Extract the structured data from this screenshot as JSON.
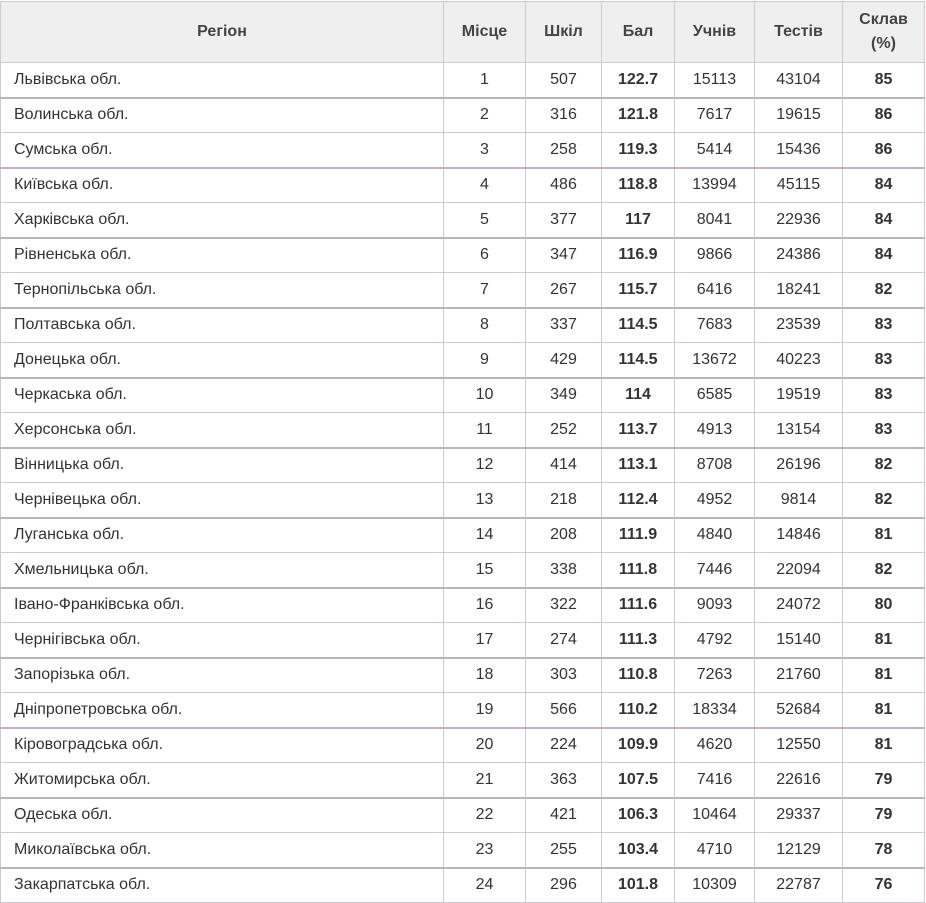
{
  "header": {
    "region": "Регіон",
    "place": "Місце",
    "schools": "Шкіл",
    "score": "Бал",
    "students": "Учнів",
    "tests": "Тестів",
    "passed": "Склав\n(%)"
  },
  "rows": [
    {
      "region": "Львівська обл.",
      "place": "1",
      "schools": "507",
      "score": "122.7",
      "students": "15113",
      "tests": "43104",
      "passed": "85"
    },
    {
      "region": "Волинська обл.",
      "place": "2",
      "schools": "316",
      "score": "121.8",
      "students": "7617",
      "tests": "19615",
      "passed": "86"
    },
    {
      "region": "Сумська обл.",
      "place": "3",
      "schools": "258",
      "score": "119.3",
      "students": "5414",
      "tests": "15436",
      "passed": "86"
    },
    {
      "region": "Київська обл.",
      "place": "4",
      "schools": "486",
      "score": "118.8",
      "students": "13994",
      "tests": "45115",
      "passed": "84"
    },
    {
      "region": "Харківська обл.",
      "place": "5",
      "schools": "377",
      "score": "117",
      "students": "8041",
      "tests": "22936",
      "passed": "84"
    },
    {
      "region": "Рівненська обл.",
      "place": "6",
      "schools": "347",
      "score": "116.9",
      "students": "9866",
      "tests": "24386",
      "passed": "84"
    },
    {
      "region": "Тернопільська обл.",
      "place": "7",
      "schools": "267",
      "score": "115.7",
      "students": "6416",
      "tests": "18241",
      "passed": "82"
    },
    {
      "region": "Полтавська обл.",
      "place": "8",
      "schools": "337",
      "score": "114.5",
      "students": "7683",
      "tests": "23539",
      "passed": "83"
    },
    {
      "region": "Донецька обл.",
      "place": "9",
      "schools": "429",
      "score": "114.5",
      "students": "13672",
      "tests": "40223",
      "passed": "83"
    },
    {
      "region": "Черкаська обл.",
      "place": "10",
      "schools": "349",
      "score": "114",
      "students": "6585",
      "tests": "19519",
      "passed": "83"
    },
    {
      "region": "Херсонська обл.",
      "place": "11",
      "schools": "252",
      "score": "113.7",
      "students": "4913",
      "tests": "13154",
      "passed": "83"
    },
    {
      "region": "Вінницька обл.",
      "place": "12",
      "schools": "414",
      "score": "113.1",
      "students": "8708",
      "tests": "26196",
      "passed": "82"
    },
    {
      "region": "Чернівецька обл.",
      "place": "13",
      "schools": "218",
      "score": "112.4",
      "students": "4952",
      "tests": "9814",
      "passed": "82"
    },
    {
      "region": "Луганська обл.",
      "place": "14",
      "schools": "208",
      "score": "111.9",
      "students": "4840",
      "tests": "14846",
      "passed": "81"
    },
    {
      "region": "Хмельницька обл.",
      "place": "15",
      "schools": "338",
      "score": "111.8",
      "students": "7446",
      "tests": "22094",
      "passed": "82"
    },
    {
      "region": "Івано-Франківська обл.",
      "place": "16",
      "schools": "322",
      "score": "111.6",
      "students": "9093",
      "tests": "24072",
      "passed": "80"
    },
    {
      "region": "Чернігівська обл.",
      "place": "17",
      "schools": "274",
      "score": "111.3",
      "students": "4792",
      "tests": "15140",
      "passed": "81"
    },
    {
      "region": "Запорізька обл.",
      "place": "18",
      "schools": "303",
      "score": "110.8",
      "students": "7263",
      "tests": "21760",
      "passed": "81"
    },
    {
      "region": "Дніпропетровська обл.",
      "place": "19",
      "schools": "566",
      "score": "110.2",
      "students": "18334",
      "tests": "52684",
      "passed": "81"
    },
    {
      "region": "Кіровоградська обл.",
      "place": "20",
      "schools": "224",
      "score": "109.9",
      "students": "4620",
      "tests": "12550",
      "passed": "81"
    },
    {
      "region": "Житомирська обл.",
      "place": "21",
      "schools": "363",
      "score": "107.5",
      "students": "7416",
      "tests": "22616",
      "passed": "79"
    },
    {
      "region": "Одеська обл.",
      "place": "22",
      "schools": "421",
      "score": "106.3",
      "students": "10464",
      "tests": "29337",
      "passed": "79"
    },
    {
      "region": "Миколаївська обл.",
      "place": "23",
      "schools": "255",
      "score": "103.4",
      "students": "4710",
      "tests": "12129",
      "passed": "78"
    },
    {
      "region": "Закарпатська обл.",
      "place": "24",
      "schools": "296",
      "score": "101.8",
      "students": "10309",
      "tests": "22787",
      "passed": "76"
    }
  ]
}
